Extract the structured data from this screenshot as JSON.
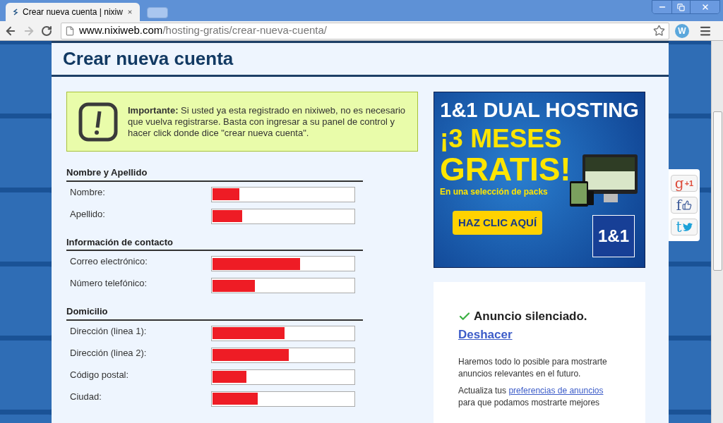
{
  "browser": {
    "tabs": [
      {
        "title": "Crear nueva cuenta | nixiw",
        "selected": true
      }
    ],
    "url_host": "www.nixiweb.com",
    "url_path": "/hosting-gratis/crear-nueva-cuenta/",
    "extension_letter": "W"
  },
  "page": {
    "title": "Crear nueva cuenta",
    "notice": "**Importante:** Si usted ya esta registrado en nixiweb, no es necesario que vuelva registrarse. Basta con ingresar a su panel de control y hacer click donde dice \"crear nueva cuenta\".",
    "sections": [
      {
        "title": "Nombre y Apellido",
        "fields": [
          {
            "label": "Nombre:",
            "level": 0.19
          },
          {
            "label": "Apellido:",
            "level": 0.21
          }
        ]
      },
      {
        "title": "Información de contacto",
        "fields": [
          {
            "label": "Correo electrónico:",
            "level": 0.62
          },
          {
            "label": "Número telefónico:",
            "level": 0.3
          }
        ]
      },
      {
        "title": "Domicilio",
        "fields": [
          {
            "label": "Dirección (linea 1):",
            "level": 0.51
          },
          {
            "label": "Dirección (linea 2):",
            "level": 0.54
          },
          {
            "label": "Código postal:",
            "level": 0.24
          },
          {
            "label": "Ciudad:",
            "level": 0.32
          }
        ]
      }
    ]
  },
  "ad": {
    "headline": "1&1 DUAL HOSTING",
    "offer_1": "¡3 MESES",
    "offer_2": "GRATIS!",
    "subline": "En una selección de packs",
    "button": "HAZ CLIC AQUÍ",
    "logo": "1&1"
  },
  "ad_notice": {
    "title": "Anuncio silenciado.",
    "undo": "Deshacer",
    "message": "Haremos todo lo posible para mostrarte anuncios relevantes en el futuro.",
    "update_before": "Actualiza tus",
    "link": "preferencias de anuncios",
    "update_after": "para que podamos mostrarte mejores"
  },
  "share": [
    {
      "kind": "google",
      "letter": "g",
      "label": "+1"
    },
    {
      "kind": "facebook",
      "letter": "f"
    },
    {
      "kind": "twitter",
      "letter": "t"
    }
  ]
}
